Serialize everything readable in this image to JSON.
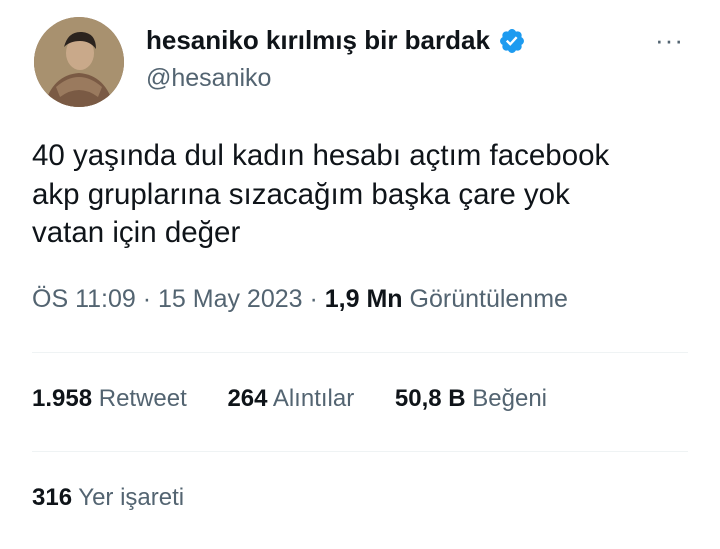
{
  "author": {
    "display_name": "hesaniko kırılmış bir bardak",
    "handle": "@hesaniko",
    "verified": true
  },
  "more_icon": "···",
  "tweet": {
    "lines": [
      "40 yaşında dul kadın hesabı açtım facebook",
      "akp gruplarına sızacağım başka çare yok",
      "vatan için değer"
    ]
  },
  "meta": {
    "time": "ÖS 11:09",
    "sep1": " · ",
    "date": "15 May 2023",
    "sep2": " · ",
    "views_count": "1,9 Mn",
    "views_label": "Görüntülenme"
  },
  "stats": {
    "retweets": {
      "count": "1.958",
      "label": "Retweet"
    },
    "quotes": {
      "count": "264",
      "label": "Alıntılar"
    },
    "likes": {
      "count": "50,8 B",
      "label": "Beğeni"
    },
    "bookmarks": {
      "count": "316",
      "label": "Yer işareti"
    }
  },
  "colors": {
    "primary_text": "#0f1419",
    "secondary_text": "#536471",
    "verified_badge": "#1d9bf0",
    "divider": "#eff3f4"
  }
}
